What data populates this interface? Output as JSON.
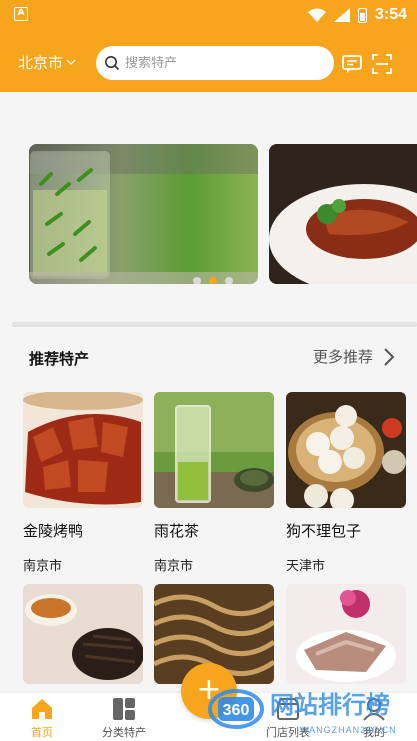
{
  "status_bar": {
    "notification_icon": "A",
    "time": "3:54"
  },
  "header": {
    "city": "北京市",
    "search_placeholder": "搜索特产",
    "right_icons": [
      "message-icon",
      "scan-icon"
    ]
  },
  "carousel": {
    "slide_count": 3,
    "active_index": 1
  },
  "recommend": {
    "title": "推荐特产",
    "more_label": "更多推荐",
    "items": [
      {
        "name": "金陵烤鸭",
        "city": "南京市"
      },
      {
        "name": "雨花茶",
        "city": "南京市"
      },
      {
        "name": "狗不理包子",
        "city": "天津市"
      }
    ]
  },
  "bottom_nav": {
    "tabs": [
      {
        "label": "首页",
        "icon": "home-icon",
        "active": true
      },
      {
        "label": "分类特产",
        "icon": "category-icon",
        "active": false
      },
      {
        "label": "门店列表",
        "icon": "store-icon",
        "active": false
      },
      {
        "label": "我的",
        "icon": "user-icon",
        "active": false
      }
    ],
    "fab_label": "+"
  },
  "watermark": {
    "logo": "360",
    "text": "网站排行榜",
    "url": "WANGZHAN360.CN"
  },
  "colors": {
    "accent": "#f7a51c",
    "background": "#f5f5f5"
  }
}
